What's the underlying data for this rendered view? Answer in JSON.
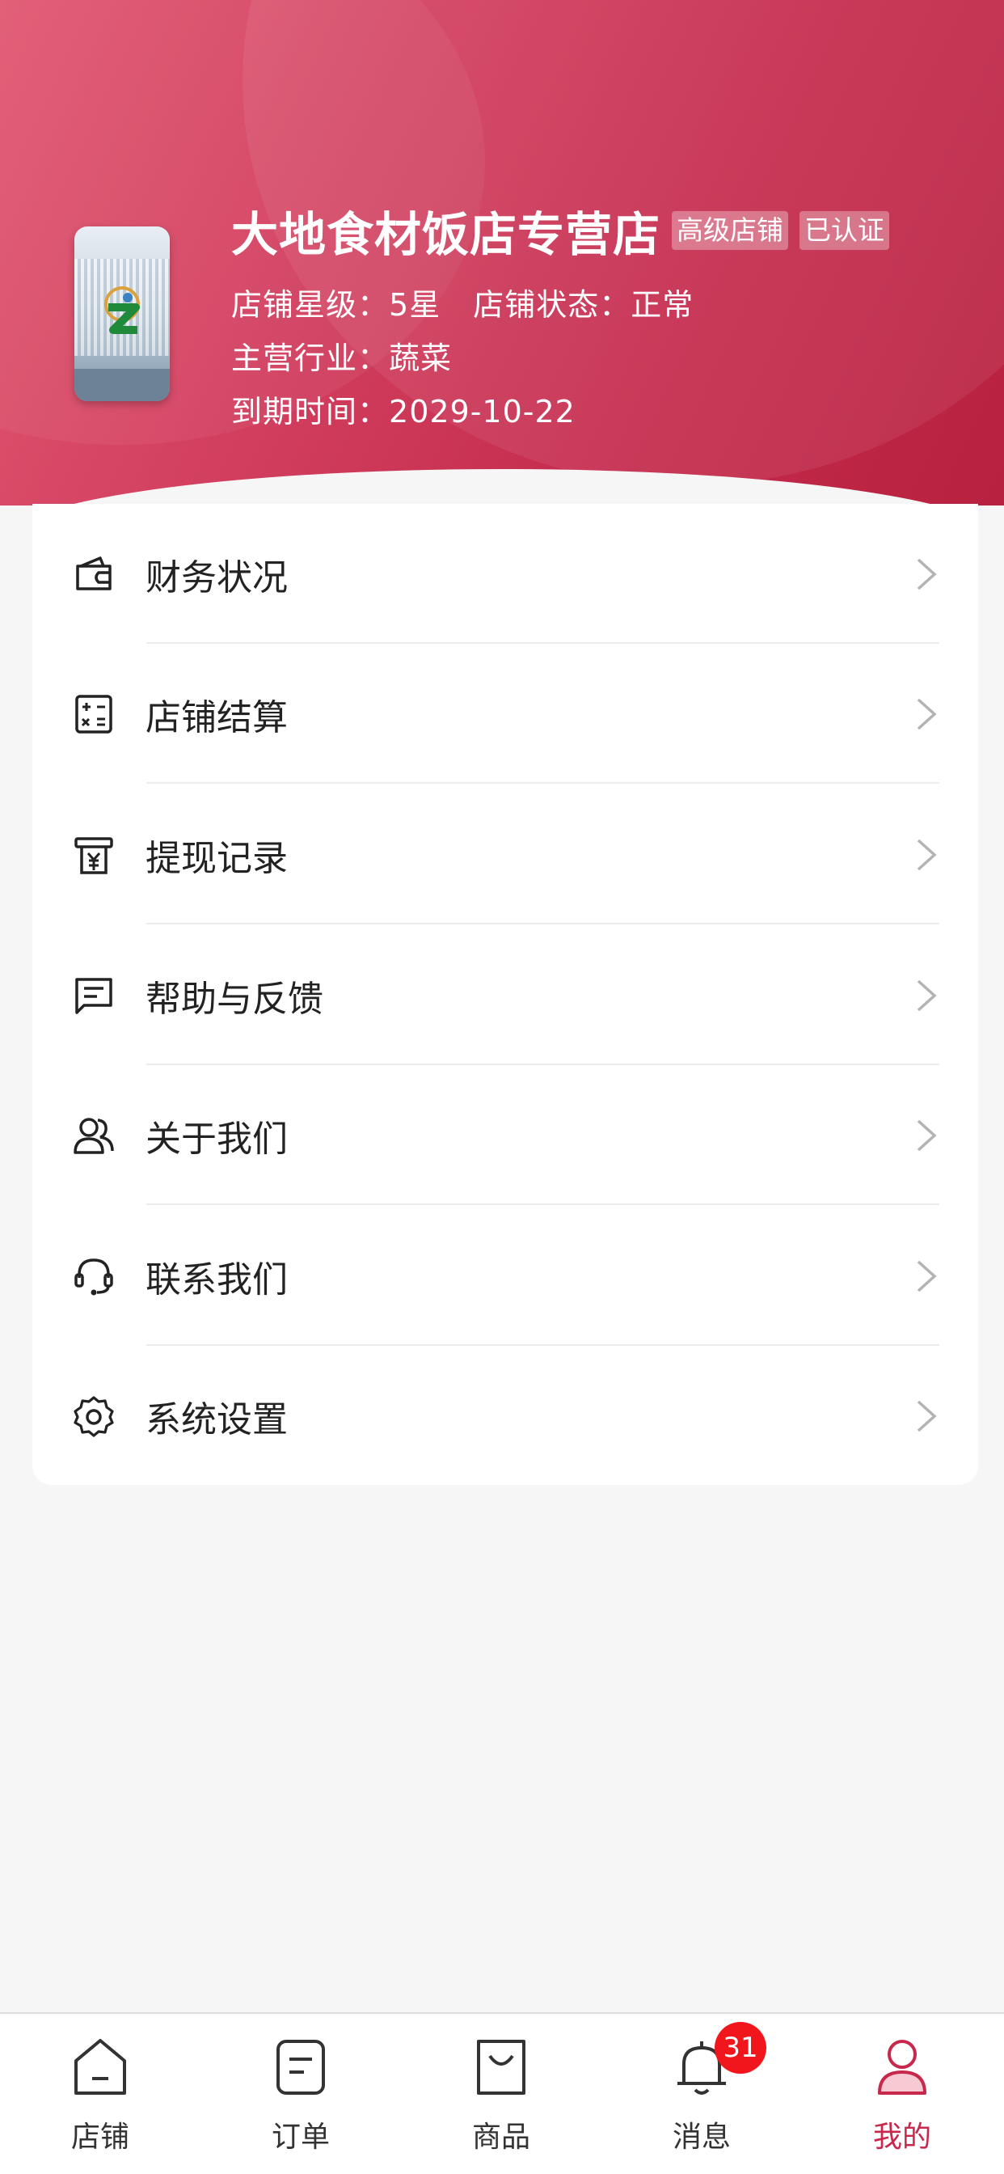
{
  "store": {
    "name": "大地食材饭店专营店",
    "tags": [
      "高级店铺",
      "已认证"
    ],
    "rating_label": "店铺星级：",
    "rating_value": "5星",
    "status_label": "店铺状态：",
    "status_value": "正常",
    "industry_label": "主营行业：",
    "industry_value": "蔬菜",
    "expiry_label": "到期时间：",
    "expiry_value": "2029-10-22"
  },
  "menu": [
    {
      "label": "财务状况",
      "icon": "wallet-icon"
    },
    {
      "label": "店铺结算",
      "icon": "calculator-icon"
    },
    {
      "label": "提现记录",
      "icon": "withdraw-receipt-icon"
    },
    {
      "label": "帮助与反馈",
      "icon": "feedback-message-icon"
    },
    {
      "label": "关于我们",
      "icon": "users-icon"
    },
    {
      "label": "联系我们",
      "icon": "headset-icon"
    },
    {
      "label": "系统设置",
      "icon": "gear-icon"
    }
  ],
  "tabbar": {
    "tabs": [
      {
        "label": "店铺",
        "icon": "store-home-icon"
      },
      {
        "label": "订单",
        "icon": "order-list-icon"
      },
      {
        "label": "商品",
        "icon": "shopping-bag-icon"
      },
      {
        "label": "消息",
        "icon": "bell-icon",
        "badge": "31"
      },
      {
        "label": "我的",
        "icon": "user-icon",
        "active": true
      }
    ]
  },
  "colors": {
    "header_start": "#e25872",
    "header_end": "#b8213f",
    "accent": "#c7284b",
    "badge": "#f0161c",
    "background": "#f6f6f6"
  }
}
